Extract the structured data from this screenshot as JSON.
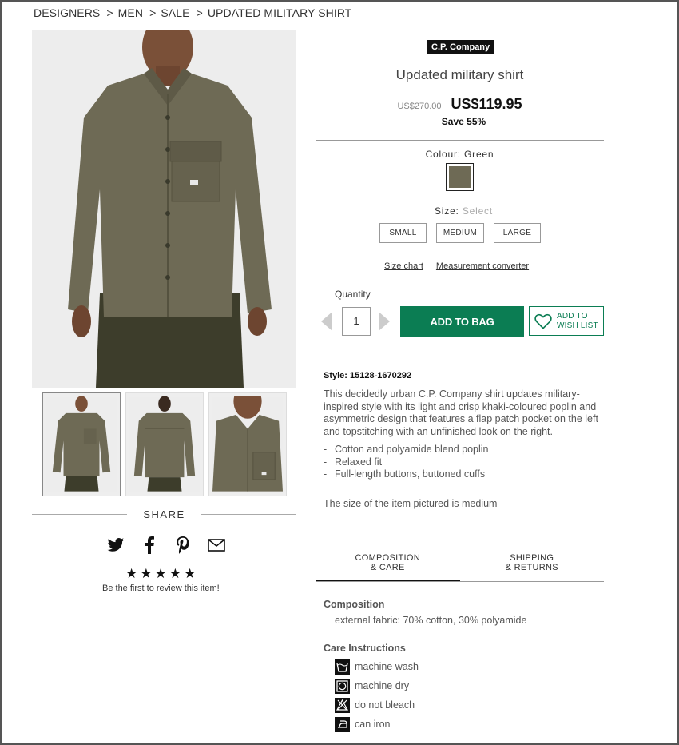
{
  "breadcrumb": {
    "items": [
      "DESIGNERS",
      "MEN",
      "SALE",
      "UPDATED MILITARY SHIRT"
    ],
    "separator": ">"
  },
  "product": {
    "brand": "C.P. Company",
    "title": "Updated military shirt",
    "old_price": "US$270.00",
    "price": "US$119.95",
    "save": "Save 55%",
    "colour_label": "Colour:",
    "colour_value": "Green",
    "swatch_color": "#6e6a55",
    "size_label": "Size:",
    "size_placeholder": "Select",
    "sizes": [
      "SMALL",
      "MEDIUM",
      "LARGE"
    ],
    "size_chart": "Size chart",
    "measurement_converter": "Measurement converter",
    "quantity_label": "Quantity",
    "quantity": "1",
    "add_to_bag": "ADD TO BAG",
    "wishlist_line1": "ADD TO",
    "wishlist_line2": "WISH LIST",
    "style_no": "Style: 15128-1670292",
    "description": "This decidedly urban C.P. Company shirt updates military-inspired style with its light and crisp khaki-coloured poplin and asymmetric design that features a flap patch pocket on the left and topstitching with an unfinished look on the right.",
    "bullets": [
      "Cotton and polyamide blend poplin",
      "Relaxed fit",
      "Full-length buttons, buttoned cuffs"
    ],
    "pictured": "The size of the item pictured is medium"
  },
  "share": {
    "label": "SHARE",
    "icons": [
      "twitter-icon",
      "facebook-icon",
      "pinterest-icon",
      "email-icon"
    ],
    "stars": "★★★★★",
    "review_link": "Be the first to review this item!"
  },
  "tabs": {
    "composition_line1": "COMPOSITION",
    "composition_line2": "& CARE",
    "shipping_line1": "SHIPPING",
    "shipping_line2": "& RETURNS"
  },
  "composition": {
    "heading": "Composition",
    "value": "external fabric: 70% cotton, 30% polyamide",
    "care_heading": "Care Instructions",
    "care": [
      "machine wash",
      "machine dry",
      "do not bleach",
      "can iron"
    ]
  },
  "colors": {
    "accent": "#0b7d53",
    "shirt": "#6e6a55"
  }
}
